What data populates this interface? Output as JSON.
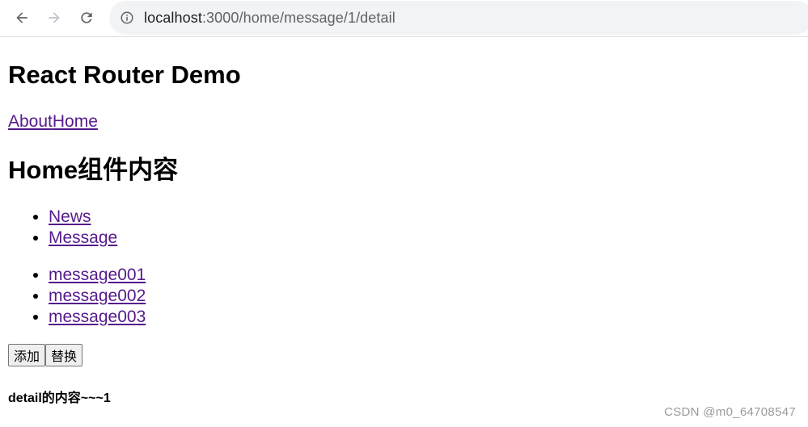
{
  "browser": {
    "url_host": "localhost",
    "url_path": ":3000/home/message/1/detail"
  },
  "page": {
    "title": "React Router Demo",
    "nav": {
      "about": "About",
      "home": "Home"
    },
    "home_heading": "Home组件内容",
    "tabs": [
      "News",
      "Message"
    ],
    "messages": [
      "message001",
      "message002",
      "message003"
    ],
    "buttons": {
      "add": "添加",
      "replace": "替换"
    },
    "detail": "detail的内容~~~1"
  },
  "watermark": "CSDN @m0_64708547",
  "colors": {
    "visited_link": "#551a8b",
    "omnibox_bg": "#f1f3f4"
  }
}
